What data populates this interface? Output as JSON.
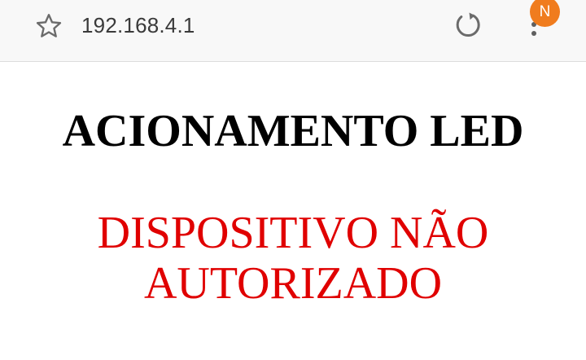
{
  "browser": {
    "url": "192.168.4.1",
    "notification_badge": "N",
    "icons": {
      "bookmark": "star-outline-icon",
      "reload": "reload-icon",
      "menu": "kebab-menu-icon"
    },
    "colors": {
      "toolbar_bg": "#f8f8f8",
      "badge": "#f07c1e"
    }
  },
  "page": {
    "title": "ACIONAMENTO LED",
    "status_line1": "DISPOSITIVO NÃO",
    "status_line2": "AUTORIZADO",
    "colors": {
      "title": "#000000",
      "status": "#e00000"
    }
  }
}
